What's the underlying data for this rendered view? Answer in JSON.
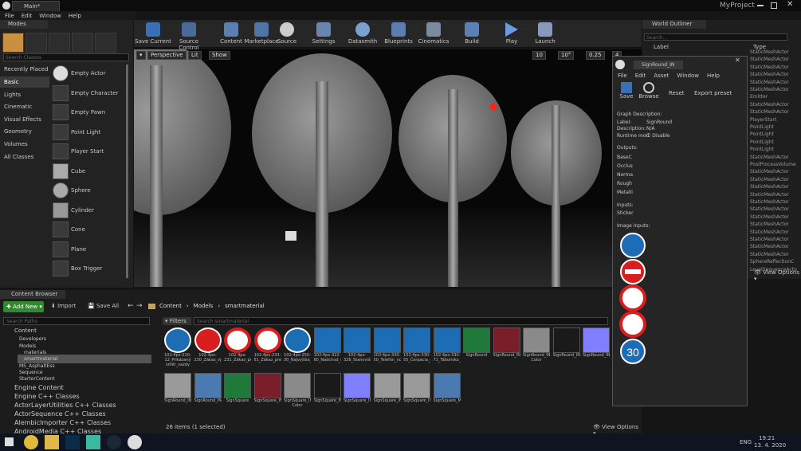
{
  "window": {
    "tab": "Main*",
    "project": "MyProject"
  },
  "menu": [
    "File",
    "Edit",
    "Window",
    "Help"
  ],
  "modes": {
    "title": "Modes",
    "search_placeholder": "Search Classes",
    "categories": [
      "Recently Placed",
      "Basic",
      "Lights",
      "Cinematic",
      "Visual Effects",
      "Geometry",
      "Volumes",
      "All Classes"
    ],
    "items": [
      "Empty Actor",
      "Empty Character",
      "Empty Pawn",
      "Point Light",
      "Player Start",
      "Cube",
      "Sphere",
      "Cylinder",
      "Cone",
      "Plane",
      "Box Trigger"
    ]
  },
  "toolbar": [
    {
      "label": "Save Current",
      "color": "#3b6fb5"
    },
    {
      "label": "Source Control",
      "color": "#4a6a9a"
    },
    {
      "label": "Content",
      "color": "#5a7fb0"
    },
    {
      "label": "Marketplace",
      "color": "#4e74a8"
    },
    {
      "label": "Source",
      "color": "#cccccc"
    },
    {
      "label": "Settings",
      "color": "#6a86b0"
    },
    {
      "label": "Datasmith",
      "color": "#7aa0d0"
    },
    {
      "label": "Blueprints",
      "color": "#5b7db0"
    },
    {
      "label": "Cinematics",
      "color": "#7a8aa0"
    },
    {
      "label": "Build",
      "color": "#5c7fb5"
    },
    {
      "label": "Play",
      "color": "#6a9ae0"
    },
    {
      "label": "Launch",
      "color": "#8899bb"
    }
  ],
  "viewport": {
    "perspective": "Perspective",
    "lit": "Lit",
    "show": "Show",
    "snap_grid": "10",
    "snap_rot": "10°",
    "snap_scale": "0.25",
    "cam_speed": "4"
  },
  "outliner": {
    "title": "World Outliner",
    "search_placeholder": "Search...",
    "col_label": "Label",
    "col_type": "Type",
    "types": [
      "StaticMeshActor",
      "StaticMeshActor",
      "StaticMeshActor",
      "StaticMeshActor",
      "StaticMeshActor",
      "StaticMeshActor",
      "Emitter",
      "StaticMeshActor",
      "StaticMeshActor",
      "PlayerStart",
      "PointLight",
      "PointLight",
      "PointLight",
      "PointLight",
      "StaticMeshActor",
      "PostProcessVolume",
      "StaticMeshActor",
      "StaticMeshActor",
      "StaticMeshActor",
      "StaticMeshActor",
      "StaticMeshActor",
      "StaticMeshActor",
      "StaticMeshActor",
      "StaticMeshActor",
      "StaticMeshActor",
      "StaticMeshActor",
      "StaticMeshActor",
      "StaticMeshActor",
      "SphereReflectionC",
      "LevelSequenceActo"
    ],
    "view_options": "View Options"
  },
  "matwin": {
    "tab": "SignRound_IN",
    "menu": [
      "File",
      "Edit",
      "Asset",
      "Window",
      "Help"
    ],
    "save": "Save",
    "browse": "Browse",
    "reset": "Reset",
    "export": "Export preset",
    "graph_desc": "Graph Description:",
    "label_key": "Label:",
    "label_val": "SignRound",
    "desc_key": "Description:",
    "desc_val": "N/A",
    "runtime": "Runtime mod",
    "disable": "Disable",
    "outputs_title": "Outputs:",
    "outputs": [
      "BaseC",
      "Occlus",
      "Norma",
      "Rough",
      "Metalli"
    ],
    "inputs_title": "Inputs:",
    "sticker": "Sticker",
    "image_inputs": "Image Inputs:",
    "thirty": "30"
  },
  "content_browser": {
    "tab": "Content Browser",
    "add_new": "Add New",
    "import": "Import",
    "save_all": "Save All",
    "breadcrumb": [
      "Content",
      "Models",
      "smartmaterial"
    ],
    "search_paths": "Search Paths",
    "filters": "Filters",
    "search_placeholder": "Search smartmaterial",
    "tree": [
      "Content",
      "Developers",
      "Models",
      "materials",
      "smartmaterial",
      "MS_AsphaltEss",
      "Sequence",
      "StarterContent"
    ],
    "sections": [
      "Engine Content",
      "Engine C++ Classes",
      "ActorLayerUtilities C++ Classes",
      "ActorSequence C++ Classes",
      "AlembicImporter C++ Classes",
      "AndroidMedia C++ Classes"
    ],
    "assets_row1": [
      {
        "name": "102-4px-210-12_Prikázaný směr_vazdy",
        "kind": "blue-arrows"
      },
      {
        "name": "102-4px-230_Zákaz_vjazdu_svg",
        "kind": "noentry"
      },
      {
        "name": "102-4px-231_Zákaz_premavky_pre",
        "kind": "ring"
      },
      {
        "name": "102-4px-233-51_Zákaz_premavky_pre",
        "kind": "moto"
      },
      {
        "name": "102-4px-250-30_Najvyššia_dovolená",
        "kind": "thirty"
      },
      {
        "name": "102-4px-322-60_Nadchod_svg",
        "kind": "bluesq"
      },
      {
        "name": "102-4px-326_Stanovište_taxi_svg",
        "kind": "taxi"
      },
      {
        "name": "102-4px-330-50_Telefón_núdzového",
        "kind": "sos"
      },
      {
        "name": "102-4px-330-55_Čerpacia_stanica_CNG",
        "kind": "cng"
      },
      {
        "name": "102-4px-330-71_Táborisko_svg",
        "kind": "camp"
      },
      {
        "name": "SignRound",
        "kind": "green-s"
      },
      {
        "name": "SignRound_INST",
        "kind": "red-s"
      },
      {
        "name": "SignRound_INST_Base Color",
        "kind": "base"
      },
      {
        "name": "SignRound_INST_Metallic",
        "kind": "dark"
      },
      {
        "name": "SignRound_INST_Normal",
        "kind": "normal"
      }
    ],
    "assets_row2": [
      {
        "name": "SignRound_INST_Roughness",
        "kind": "rough"
      },
      {
        "name": "SignRound_MAT",
        "kind": "mat"
      },
      {
        "name": "SignSquare",
        "kind": "green-s"
      },
      {
        "name": "SignSquare_INST",
        "kind": "red-s"
      },
      {
        "name": "SignSquare_INST_Base Color",
        "kind": "base"
      },
      {
        "name": "SignSquare_INST_Metallic",
        "kind": "dark"
      },
      {
        "name": "SignSquare_INST_Normal",
        "kind": "normal"
      },
      {
        "name": "SignSquare_INST_Occlusion",
        "kind": "rough"
      },
      {
        "name": "SignSquare_INST_Roughness",
        "kind": "rough"
      },
      {
        "name": "SignSquare_MAT",
        "kind": "mat"
      }
    ],
    "status": "26 items (1 selected)",
    "view_options": "View Options"
  },
  "taskbar": {
    "lang": "ENG",
    "time": "19:21",
    "date": "13. 4. 2020"
  }
}
